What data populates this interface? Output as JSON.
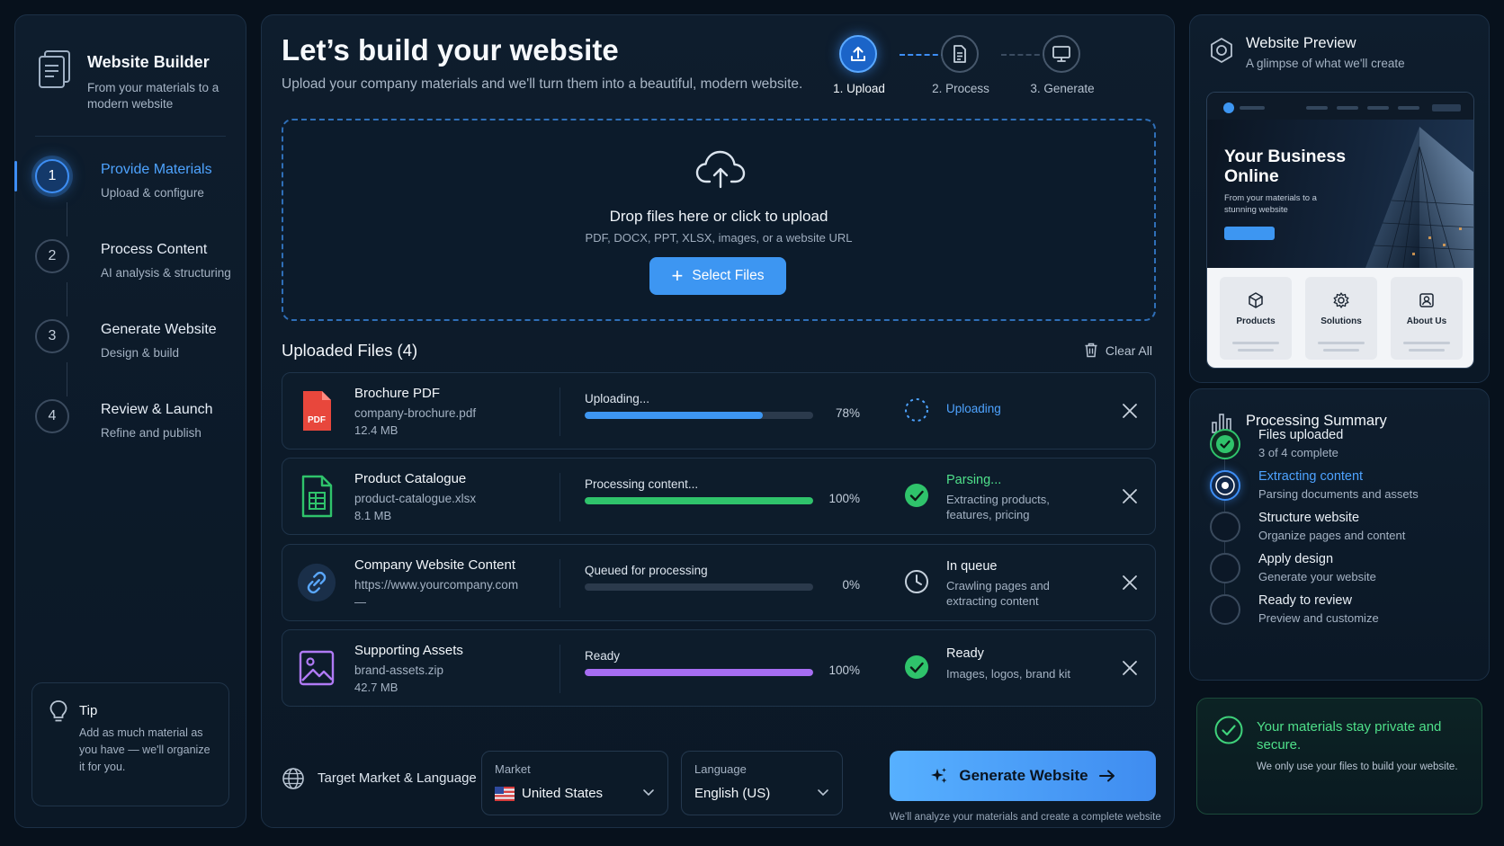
{
  "sidebar": {
    "brand_title": "Website Builder",
    "brand_sub": "From your materials to a modern website",
    "steps": [
      {
        "num": "1",
        "title": "Provide Materials",
        "sub": "Upload & configure",
        "active": true
      },
      {
        "num": "2",
        "title": "Process Content",
        "sub": "AI analysis & structuring",
        "active": false
      },
      {
        "num": "3",
        "title": "Generate Website",
        "sub": "Design & build",
        "active": false
      },
      {
        "num": "4",
        "title": "Review & Launch",
        "sub": "Refine and publish",
        "active": false
      }
    ],
    "tip_title": "Tip",
    "tip_text": "Add as much material as you have — we'll organize it for you."
  },
  "main": {
    "title": "Let’s build your website",
    "subtitle": "Upload your company materials and we'll turn them into a beautiful, modern website.",
    "stepper": [
      {
        "label": "1. Upload",
        "icon": "upload-icon",
        "active": true
      },
      {
        "label": "2. Process",
        "icon": "document-icon",
        "active": false
      },
      {
        "label": "3. Generate",
        "icon": "monitor-icon",
        "active": false
      }
    ],
    "dropzone": {
      "title": "Drop files here or click to upload",
      "sub": "PDF, DOCX, PPT, XLSX, images, or a website URL",
      "button_label": "Select Files"
    },
    "files_heading": "Uploaded Files (4)",
    "clear_all": "Clear All",
    "files": [
      {
        "name": "Brochure PDF",
        "path": "company-brochure.pdf",
        "size": "12.4 MB",
        "progress_label": "Uploading...",
        "progress": 78,
        "pct": "78%",
        "color": "#3d96f2",
        "status_title": "Uploading",
        "status_sub": "",
        "status_color": "#4ea3ff",
        "icon": "pdf-icon",
        "status_icon": "spinner-icon"
      },
      {
        "name": "Product Catalogue",
        "path": "product-catalogue.xlsx",
        "size": "8.1 MB",
        "progress_label": "Processing content...",
        "progress": 100,
        "pct": "100%",
        "color": "#2fc36b",
        "status_title": "Parsing...",
        "status_sub": "Extracting products, features, pricing",
        "status_color": "#4fe08a",
        "icon": "spreadsheet-icon",
        "status_icon": "check-circle-icon"
      },
      {
        "name": "Company Website Content",
        "path": "https://www.yourcompany.com",
        "size": "—",
        "progress_label": "Queued for processing",
        "progress": 0,
        "pct": "0%",
        "color": "#3d96f2",
        "status_title": "In queue",
        "status_sub": "Crawling pages and extracting content",
        "status_color": "#f0f5fa",
        "icon": "link-icon",
        "status_icon": "clock-icon"
      },
      {
        "name": "Supporting Assets",
        "path": "brand-assets.zip",
        "size": "42.7 MB",
        "progress_label": "Ready",
        "progress": 100,
        "pct": "100%",
        "color": "#a66df2",
        "status_title": "Ready",
        "status_sub": "Images, logos, brand kit",
        "status_color": "#f0f5fa",
        "icon": "image-icon",
        "status_icon": "check-circle-icon"
      }
    ],
    "market": {
      "label": "Target Market & Language",
      "market_caption": "Market",
      "market_value": "United States",
      "language_caption": "Language",
      "language_value": "English (US)"
    },
    "generate_label": "Generate Website",
    "generate_note": "We'll analyze your materials and create a complete website"
  },
  "preview": {
    "title": "Website Preview",
    "sub": "A glimpse of what we'll create",
    "hero_title": "Your Business Online",
    "hero_sub": "From your materials to a stunning website",
    "tiles": [
      "Products",
      "Solutions",
      "About Us"
    ]
  },
  "summary": {
    "title": "Processing Summary",
    "items": [
      {
        "label": "Files uploaded",
        "sub": "3 of 4 complete",
        "state": "done"
      },
      {
        "label": "Extracting content",
        "sub": "Parsing documents and assets",
        "state": "active"
      },
      {
        "label": "Structure website",
        "sub": "Organize pages and content",
        "state": "pending"
      },
      {
        "label": "Apply design",
        "sub": "Generate your website",
        "state": "pending"
      },
      {
        "label": "Ready to review",
        "sub": "Preview and customize",
        "state": "pending"
      }
    ]
  },
  "privacy": {
    "title": "Your materials stay private and secure.",
    "sub": "We only use your files to build your website."
  },
  "colors": {
    "accent": "#3d96f2",
    "success": "#2fc36b",
    "purple": "#a66df2",
    "background": "#07111c"
  }
}
